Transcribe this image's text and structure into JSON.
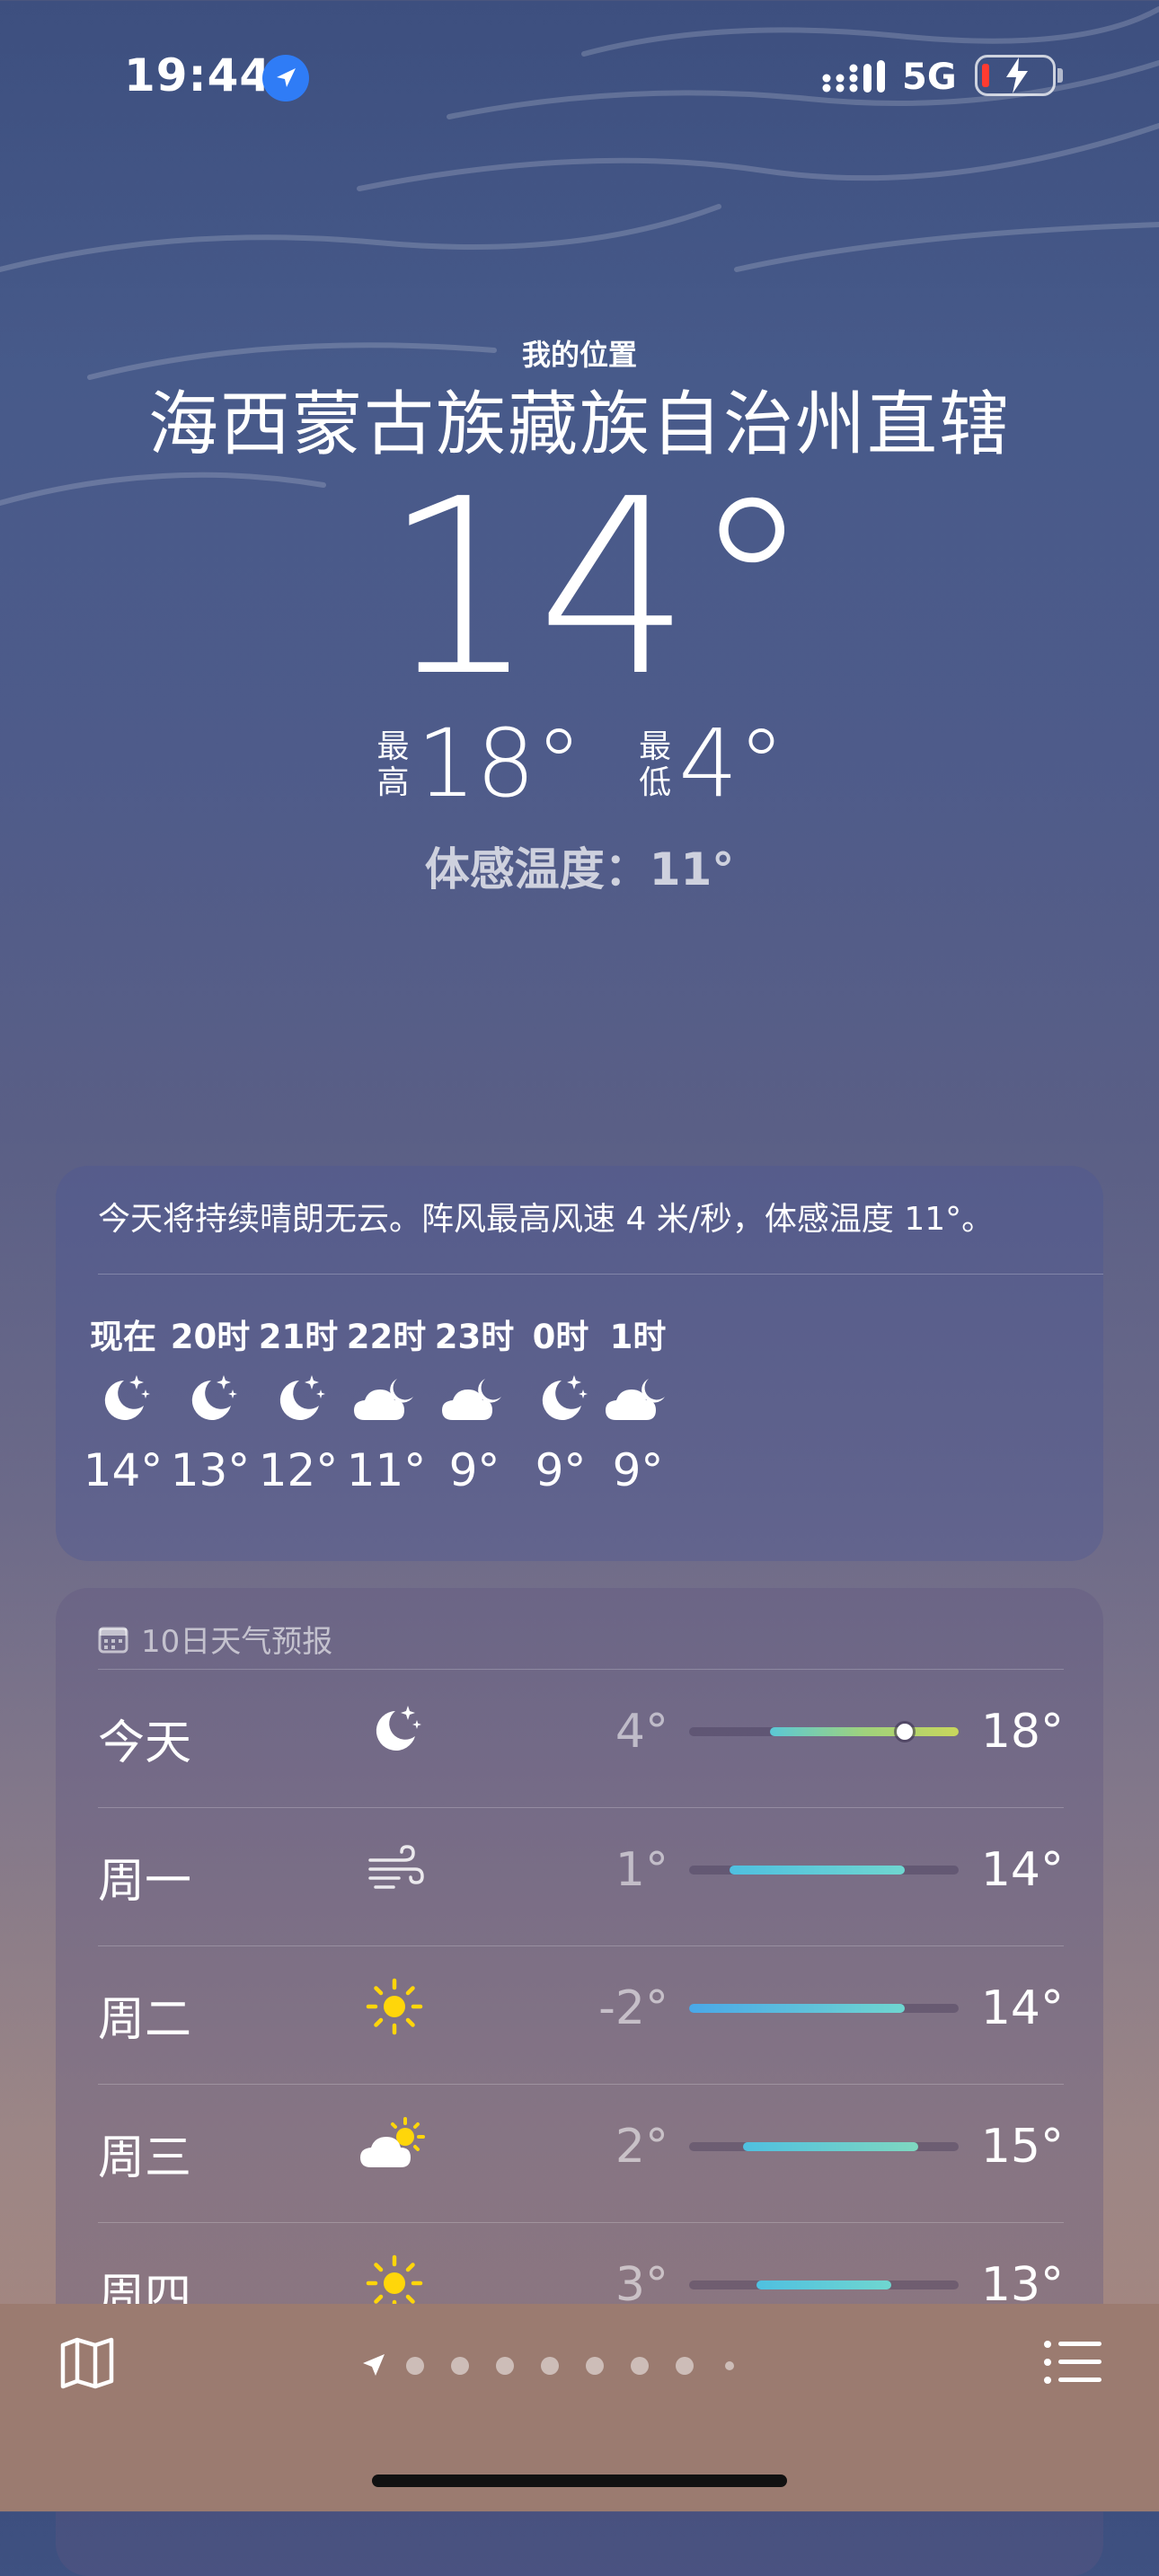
{
  "status_bar": {
    "time": "19:44",
    "network": "5G"
  },
  "header": {
    "my_location_label": "我的位置",
    "place": "海西蒙古族藏族自治州直辖",
    "current_temp": "14°",
    "high_label": "最高",
    "high_value": "18°",
    "low_label": "最低",
    "low_value": "4°",
    "feels_like": "体感温度：11°"
  },
  "hourly": {
    "summary": "今天将持续晴朗无云。阵风最高风速 4 米/秒，体感温度 11°。",
    "hours": [
      {
        "label": "现在",
        "icon": "moon-stars-icon",
        "temp": "14°"
      },
      {
        "label": "20时",
        "icon": "moon-stars-icon",
        "temp": "13°"
      },
      {
        "label": "21时",
        "icon": "moon-stars-icon",
        "temp": "12°"
      },
      {
        "label": "22时",
        "icon": "cloud-moon-icon",
        "temp": "11°"
      },
      {
        "label": "23时",
        "icon": "cloud-moon-icon",
        "temp": "9°"
      },
      {
        "label": "0时",
        "icon": "moon-stars-icon",
        "temp": "9°"
      },
      {
        "label": "1时",
        "icon": "cloud-moon-icon",
        "temp": "9°"
      }
    ]
  },
  "forecast": {
    "title": "10日天气预报",
    "range_min": -2,
    "range_max": 18,
    "days": [
      {
        "day": "今天",
        "icon": "moon-stars-icon",
        "low": "4°",
        "high": "18°",
        "low_num": 4,
        "high_num": 18,
        "current_num": 14,
        "colors": [
          "#5bc8d6",
          "#9fd27c",
          "#c8d65c"
        ]
      },
      {
        "day": "周一",
        "icon": "wind-icon",
        "low": "1°",
        "high": "14°",
        "low_num": 1,
        "high_num": 14,
        "colors": [
          "#4fc0e0",
          "#6fd6d0"
        ]
      },
      {
        "day": "周二",
        "icon": "sun-icon",
        "low": "-2°",
        "high": "14°",
        "low_num": -2,
        "high_num": 14,
        "colors": [
          "#4aa8e8",
          "#6fd6d0"
        ]
      },
      {
        "day": "周三",
        "icon": "cloud-sun-icon",
        "low": "2°",
        "high": "15°",
        "low_num": 2,
        "high_num": 15,
        "colors": [
          "#4fc0e0",
          "#7fd8c0"
        ]
      },
      {
        "day": "周四",
        "icon": "sun-icon",
        "low": "3°",
        "high": "13°",
        "low_num": 3,
        "high_num": 13,
        "colors": [
          "#4fc0e0",
          "#6fd6d0"
        ]
      }
    ]
  },
  "page_dots": {
    "count": 9,
    "active_index": 0
  }
}
